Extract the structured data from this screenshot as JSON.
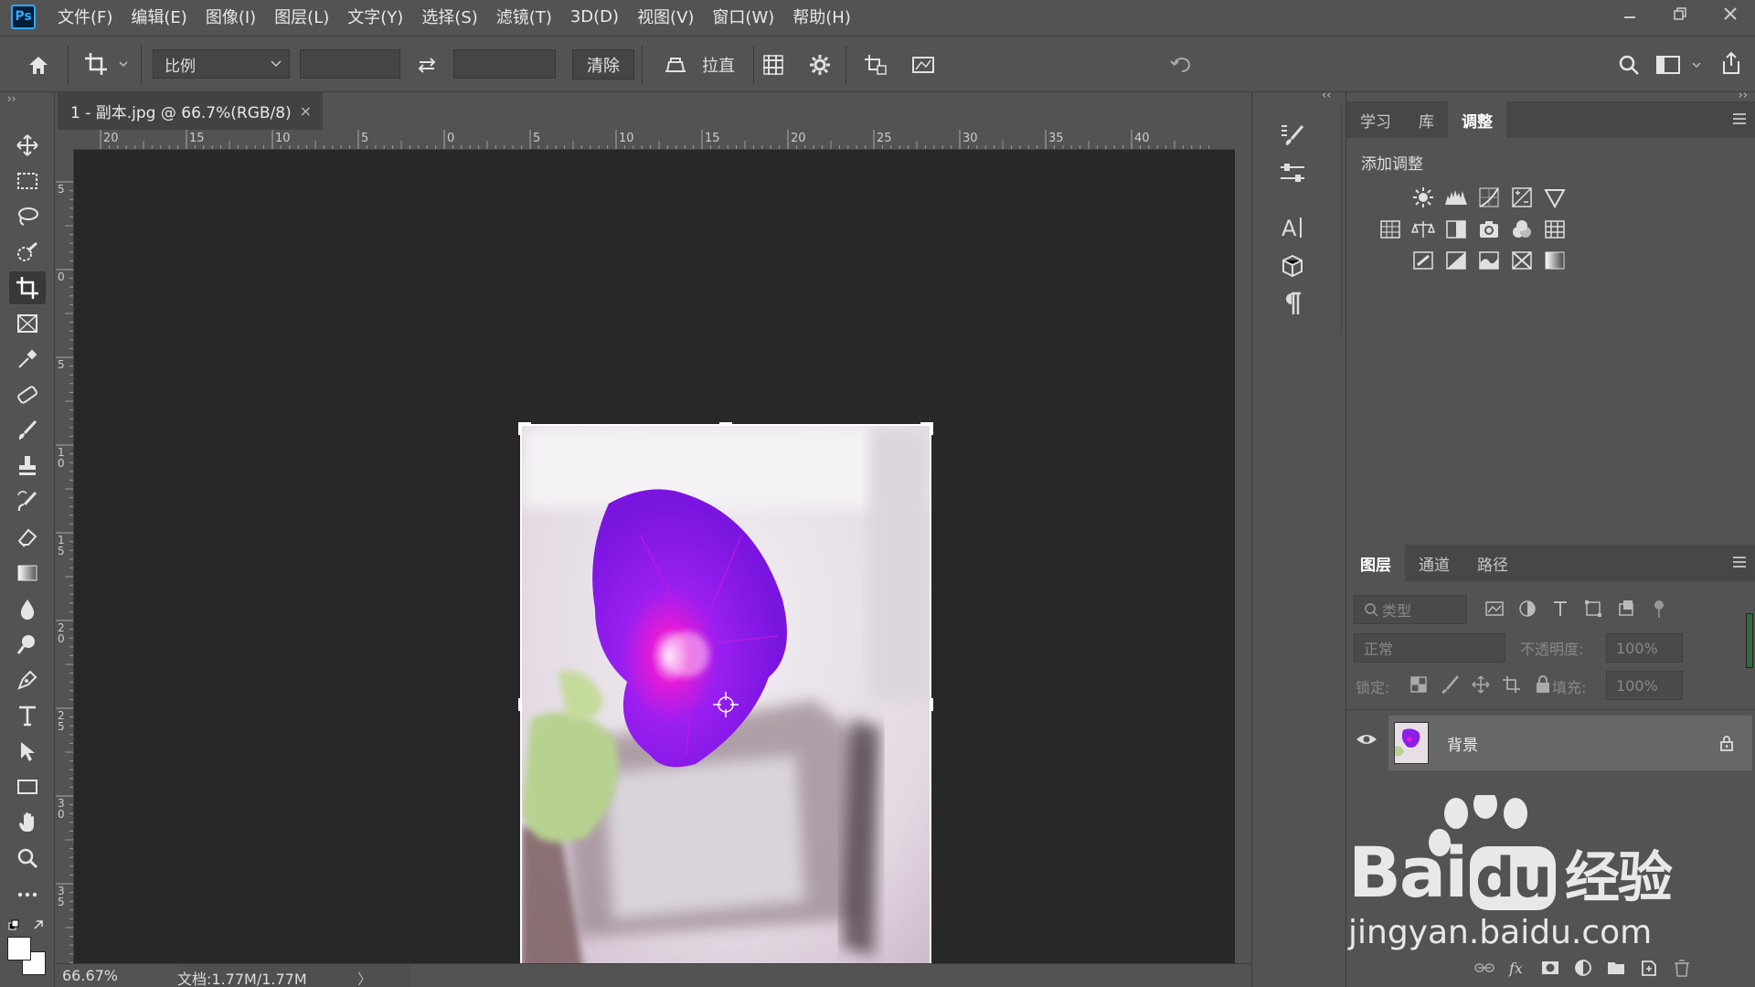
{
  "app": {
    "logo": "Ps"
  },
  "menu": [
    "文件(F)",
    "编辑(E)",
    "图像(I)",
    "图层(L)",
    "文字(Y)",
    "选择(S)",
    "滤镜(T)",
    "3D(D)",
    "视图(V)",
    "窗口(W)",
    "帮助(H)"
  ],
  "options": {
    "ratio_select": "比例",
    "clear_label": "清除",
    "straighten_label": "拉直"
  },
  "document": {
    "tab_title": "1 - 副本.jpg @ 66.7%(RGB/8)",
    "close": "×"
  },
  "ruler": {
    "h_labels": [
      "20",
      "15",
      "10",
      "5",
      "0",
      "5",
      "10",
      "15",
      "20",
      "25",
      "30",
      "35",
      "40"
    ],
    "v_labels": [
      "5",
      "0",
      "5",
      "10",
      "15",
      "20",
      "25",
      "30",
      "35"
    ]
  },
  "status": {
    "zoom": "66.67%",
    "doc_info": "文档:1.77M/1.77M",
    "arrow": "〉"
  },
  "adjust_panel": {
    "tabs": [
      "学习",
      "库",
      "调整"
    ],
    "active_tab": "调整",
    "title": "添加调整"
  },
  "layers_panel": {
    "tabs": [
      "图层",
      "通道",
      "路径"
    ],
    "active_tab": "图层",
    "filter_placeholder": "类型",
    "blend_mode": "正常",
    "opacity_label": "不透明度:",
    "opacity_value": "100%",
    "lock_label": "锁定:",
    "fill_label": "填充:",
    "fill_value": "100%",
    "layers": [
      {
        "name": "背景",
        "visible": true,
        "locked": true
      }
    ]
  },
  "watermark": {
    "brand": "Bai",
    "brand2": "du",
    "cn": "经验",
    "url": "jingyan.baidu.com"
  },
  "colors": {
    "accent": "#31a8ff",
    "panel": "#535353",
    "canvas": "#282828",
    "flower": "#8a1fe6"
  }
}
